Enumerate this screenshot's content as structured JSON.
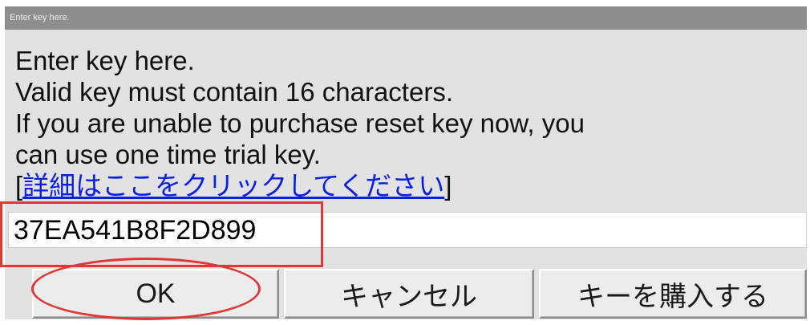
{
  "window": {
    "title": "Enter key here."
  },
  "message": {
    "lines": [
      "Enter key here.",
      "Valid key must contain 16 characters.",
      "If you are unable to purchase reset key now, you",
      "can use one time trial key."
    ],
    "link_open": "[",
    "link_text": "詳細はここをクリックしてください",
    "link_close": "]"
  },
  "key_input": {
    "value": "37EA541B8F2D899"
  },
  "buttons": {
    "ok": "OK",
    "cancel": "キャンセル",
    "buy": "キーを購入する"
  },
  "colors": {
    "dialog_bg": "#e2e2e2",
    "titlebar_bg": "#8e8e8e",
    "link": "#0a1fe0",
    "annotation": "#e03636"
  }
}
